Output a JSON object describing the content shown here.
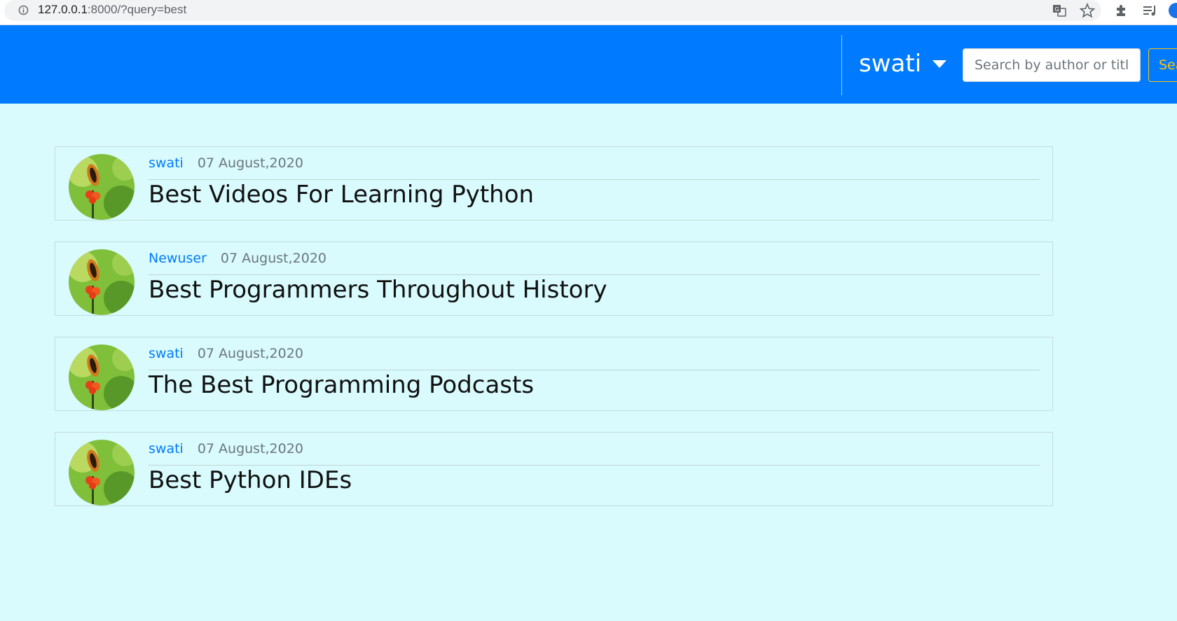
{
  "browser": {
    "url_host": "127.0.0.1",
    "url_rest": ":8000/?query=best"
  },
  "navbar": {
    "user_name": "swati",
    "search_placeholder": "Search by author or title",
    "search_button_label": "Search"
  },
  "posts": [
    {
      "author": "swati",
      "date": "07 August,2020",
      "title": "Best Videos For Learning Python"
    },
    {
      "author": "Newuser",
      "date": "07 August,2020",
      "title": "Best Programmers Throughout History"
    },
    {
      "author": "swati",
      "date": "07 August,2020",
      "title": "The Best Programming Podcasts"
    },
    {
      "author": "swati",
      "date": "07 August,2020",
      "title": "Best Python IDEs"
    }
  ],
  "colors": {
    "navbar": "#007bff",
    "page_background": "#d9fbfd",
    "author_link": "#007bff",
    "search_button": "#ffc107"
  },
  "icons": {
    "info": "info-icon",
    "translate": "translate-icon",
    "bookmark": "star-icon",
    "extensions": "puzzle-icon",
    "reading_list": "reading-list-icon",
    "profile": "profile-icon",
    "dropdown": "caret-down-icon"
  }
}
